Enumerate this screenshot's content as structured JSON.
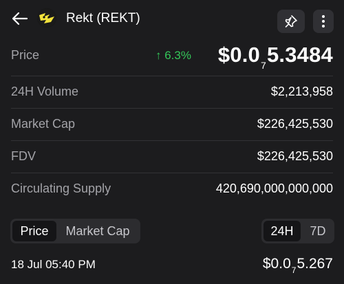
{
  "header": {
    "token_name": "Rekt (REKT)",
    "icons": {
      "back": "arrow-left-icon",
      "logo": "rekt-token-logo",
      "pin": "pin-icon",
      "more": "more-vertical-icon"
    }
  },
  "price": {
    "label": "Price",
    "change": "↑ 6.3%",
    "value_prefix": "$0.0",
    "zero_count": "7",
    "value_suffix": "5.3484"
  },
  "stats": [
    {
      "label": "24H Volume",
      "value": "$2,213,958"
    },
    {
      "label": "Market Cap",
      "value": "$226,425,530"
    },
    {
      "label": "FDV",
      "value": "$226,425,530"
    },
    {
      "label": "Circulating Supply",
      "value": "420,690,000,000,000"
    }
  ],
  "chart_toggle": {
    "metric": [
      "Price",
      "Market Cap"
    ],
    "metric_selected": "Price",
    "range": [
      "24H",
      "7D"
    ],
    "range_selected": "24H"
  },
  "chart_point": {
    "timestamp": "18 Jul 05:40 PM",
    "price_prefix": "$0.0",
    "zero_count": "7",
    "price_suffix": "5.267"
  },
  "colors": {
    "background": "#1c1c1e",
    "positive": "#34c759",
    "label": "#a3a3a8"
  }
}
